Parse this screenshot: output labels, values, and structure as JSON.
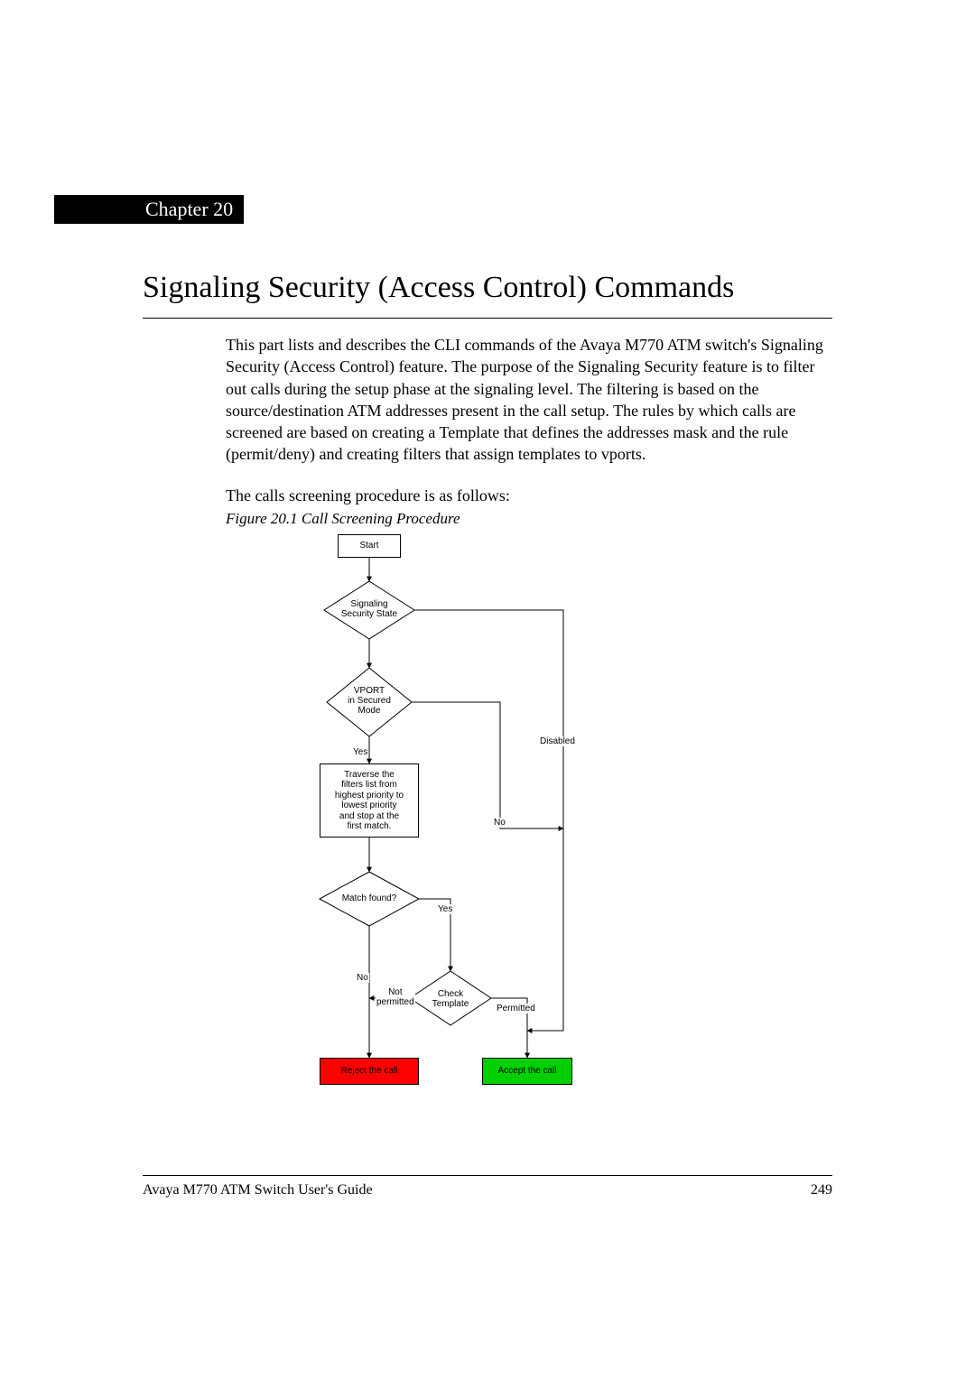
{
  "chapter": {
    "label": "Chapter 20"
  },
  "title": "Signaling Security (Access Control) Commands",
  "para1": "This part lists and describes the CLI commands of the Avaya M770 ATM switch's Signaling Security (Access Control) feature. The purpose of the Signaling Security feature is to filter out calls during the setup phase at the signaling level. The filtering is based on the source/destination ATM addresses present in the call setup. The rules by which calls are screened are based on creating a Template that defines the addresses mask and the rule (permit/deny) and creating filters that assign templates to vports.",
  "para2": "The calls screening procedure is as follows:",
  "figure_caption": "Figure 20.1    Call Screening Procedure",
  "flow": {
    "start": "Start",
    "sig_state": "Signaling\nSecurity State",
    "vport": "VPORT\nin Secured\nMode",
    "traverse": "Traverse the\nfilters list from\nhighest priority to\nlowest priority\nand stop at the\nfirst match.",
    "match": "Match found?",
    "check": "Check\nTemplate",
    "reject": "Reject the call",
    "accept": "Accept the call",
    "labels": {
      "disabled": "Disabled",
      "yes1": "Yes",
      "no_vport": "No",
      "yes_match": "Yes",
      "no_match": "No",
      "not_permitted": "Not\npermitted",
      "permitted": "Permitted"
    }
  },
  "footer": {
    "left": "Avaya M770 ATM Switch User's Guide",
    "right": "249"
  }
}
